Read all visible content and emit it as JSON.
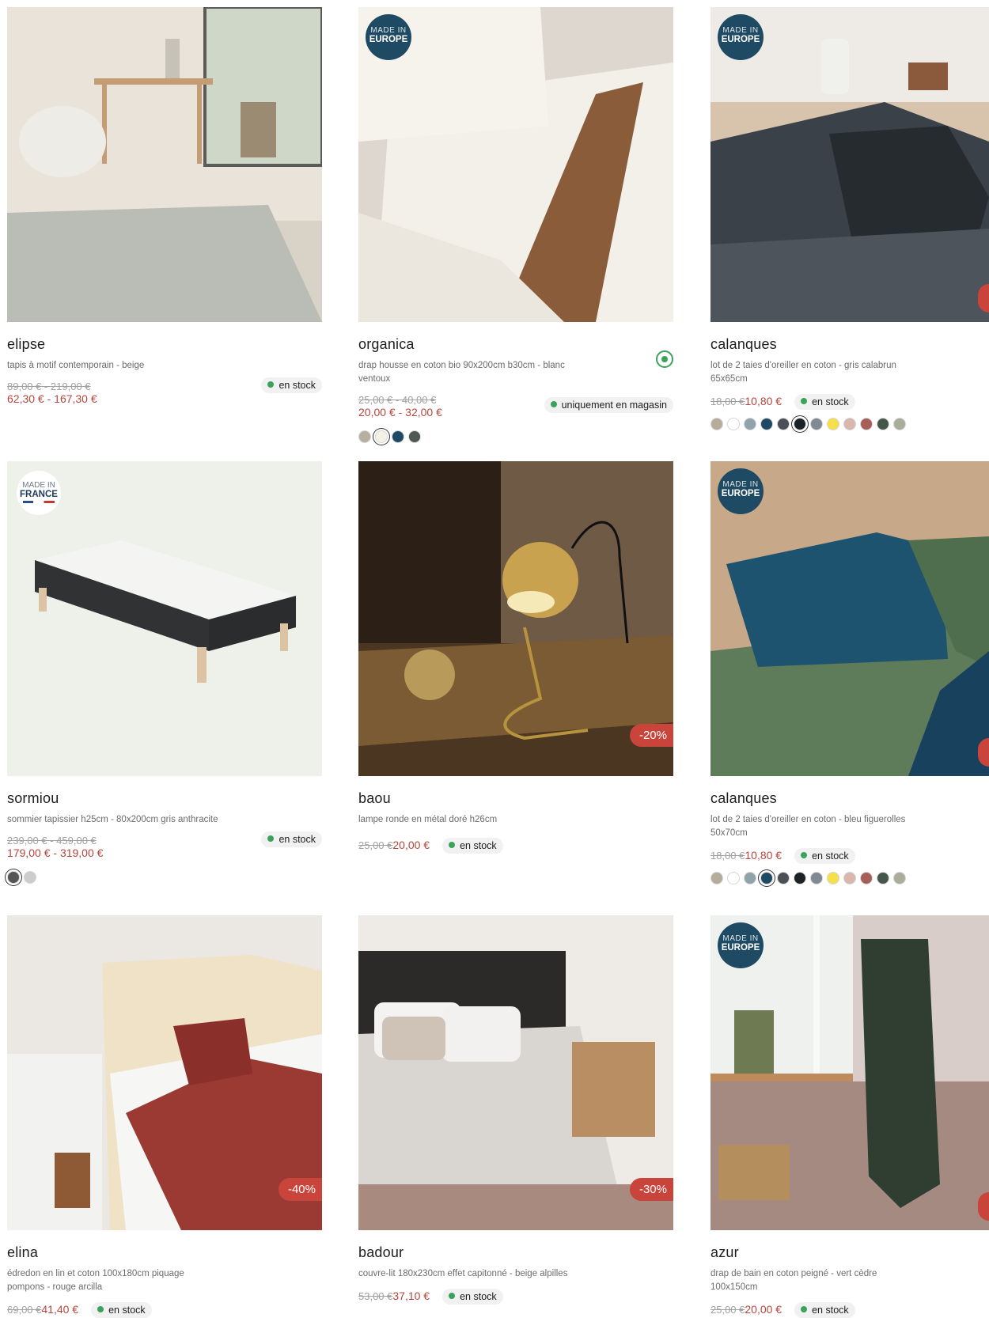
{
  "badges": {
    "europe_l1": "MADE IN",
    "europe_l2": "EUROPE",
    "france_l1": "MADE IN",
    "france_l2": "FRANCE"
  },
  "colors": {
    "price": "#b5463d",
    "stock_dot": "#3aa35b",
    "discount": "#c9453c",
    "badge_eu": "#1f4a63"
  },
  "products": [
    {
      "title": "elipse",
      "desc": "tapis à motif contemporain - beige",
      "old_price": "89,00 € - 219,00 €",
      "price": "62,30 € - 167,30 €",
      "stock": "en stock"
    },
    {
      "title": "organica",
      "desc": "drap housse en coton bio 90x200cm b30cm - blanc ventoux",
      "old_price": "25,00 € - 40,00 €",
      "price": "20,00 € - 32,00 €",
      "stock": "uniquement en magasin"
    },
    {
      "title": "calanques",
      "desc": "lot de 2 taies d'oreiller en coton - gris calabrun 65x65cm",
      "old_price": "18,00 €",
      "price": "10,80 €",
      "stock": "en stock"
    },
    {
      "title": "sormiou",
      "desc": "sommier tapissier h25cm - 80x200cm gris anthracite",
      "old_price": "239,00 € - 459,00 €",
      "price": "179,00 € - 319,00 €",
      "stock": "en stock"
    },
    {
      "title": "baou",
      "desc": "lampe ronde en métal doré h26cm",
      "old_price": "25,00 €",
      "price": "20,00 €",
      "stock": "en stock",
      "discount": "-20%"
    },
    {
      "title": "calanques",
      "desc": "lot de 2 taies d'oreiller en coton - bleu figuerolles 50x70cm",
      "old_price": "18,00 €",
      "price": "10,80 €",
      "stock": "en stock"
    },
    {
      "title": "elina",
      "desc": "édredon en lin et coton 100x180cm piquage pompons - rouge arcilla",
      "old_price": "69,00 €",
      "price": "41,40 €",
      "stock": "en stock",
      "discount": "-40%"
    },
    {
      "title": "badour",
      "desc": "couvre-lit 180x230cm effet capitonné - beige alpilles",
      "old_price": "53,00 €",
      "price": "37,10 €",
      "stock": "en stock",
      "discount": "-30%"
    },
    {
      "title": "azur",
      "desc": "drap de bain en coton peigné - vert cèdre 100x150cm",
      "old_price": "25,00 €",
      "price": "20,00 €",
      "stock": "en stock"
    }
  ],
  "swatches": {
    "organica": [
      "#b7b0a0",
      "#f4f1e6",
      "#1f4a63",
      "#4f5852"
    ],
    "calanques": [
      "#b5ac9a",
      "#ffffff",
      "#8fa3ab",
      "#1f4a63",
      "#4c5056",
      "#1d2226",
      "#7f8a94",
      "#f4e04a",
      "#d9b7ad",
      "#a55f58",
      "#44574a",
      "#a9ad9a"
    ],
    "sormiou": [
      "#555555",
      "#cccccc"
    ]
  }
}
